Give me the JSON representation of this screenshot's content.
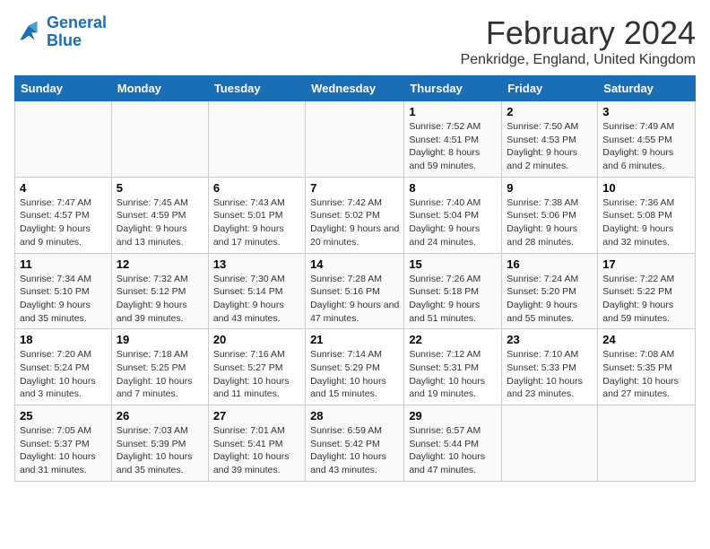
{
  "logo": {
    "line1": "General",
    "line2": "Blue"
  },
  "title": "February 2024",
  "subtitle": "Penkridge, England, United Kingdom",
  "days_of_week": [
    "Sunday",
    "Monday",
    "Tuesday",
    "Wednesday",
    "Thursday",
    "Friday",
    "Saturday"
  ],
  "weeks": [
    [
      {
        "day": "",
        "info": ""
      },
      {
        "day": "",
        "info": ""
      },
      {
        "day": "",
        "info": ""
      },
      {
        "day": "",
        "info": ""
      },
      {
        "day": "1",
        "info": "Sunrise: 7:52 AM\nSunset: 4:51 PM\nDaylight: 8 hours and 59 minutes."
      },
      {
        "day": "2",
        "info": "Sunrise: 7:50 AM\nSunset: 4:53 PM\nDaylight: 9 hours and 2 minutes."
      },
      {
        "day": "3",
        "info": "Sunrise: 7:49 AM\nSunset: 4:55 PM\nDaylight: 9 hours and 6 minutes."
      }
    ],
    [
      {
        "day": "4",
        "info": "Sunrise: 7:47 AM\nSunset: 4:57 PM\nDaylight: 9 hours and 9 minutes."
      },
      {
        "day": "5",
        "info": "Sunrise: 7:45 AM\nSunset: 4:59 PM\nDaylight: 9 hours and 13 minutes."
      },
      {
        "day": "6",
        "info": "Sunrise: 7:43 AM\nSunset: 5:01 PM\nDaylight: 9 hours and 17 minutes."
      },
      {
        "day": "7",
        "info": "Sunrise: 7:42 AM\nSunset: 5:02 PM\nDaylight: 9 hours and 20 minutes."
      },
      {
        "day": "8",
        "info": "Sunrise: 7:40 AM\nSunset: 5:04 PM\nDaylight: 9 hours and 24 minutes."
      },
      {
        "day": "9",
        "info": "Sunrise: 7:38 AM\nSunset: 5:06 PM\nDaylight: 9 hours and 28 minutes."
      },
      {
        "day": "10",
        "info": "Sunrise: 7:36 AM\nSunset: 5:08 PM\nDaylight: 9 hours and 32 minutes."
      }
    ],
    [
      {
        "day": "11",
        "info": "Sunrise: 7:34 AM\nSunset: 5:10 PM\nDaylight: 9 hours and 35 minutes."
      },
      {
        "day": "12",
        "info": "Sunrise: 7:32 AM\nSunset: 5:12 PM\nDaylight: 9 hours and 39 minutes."
      },
      {
        "day": "13",
        "info": "Sunrise: 7:30 AM\nSunset: 5:14 PM\nDaylight: 9 hours and 43 minutes."
      },
      {
        "day": "14",
        "info": "Sunrise: 7:28 AM\nSunset: 5:16 PM\nDaylight: 9 hours and 47 minutes."
      },
      {
        "day": "15",
        "info": "Sunrise: 7:26 AM\nSunset: 5:18 PM\nDaylight: 9 hours and 51 minutes."
      },
      {
        "day": "16",
        "info": "Sunrise: 7:24 AM\nSunset: 5:20 PM\nDaylight: 9 hours and 55 minutes."
      },
      {
        "day": "17",
        "info": "Sunrise: 7:22 AM\nSunset: 5:22 PM\nDaylight: 9 hours and 59 minutes."
      }
    ],
    [
      {
        "day": "18",
        "info": "Sunrise: 7:20 AM\nSunset: 5:24 PM\nDaylight: 10 hours and 3 minutes."
      },
      {
        "day": "19",
        "info": "Sunrise: 7:18 AM\nSunset: 5:25 PM\nDaylight: 10 hours and 7 minutes."
      },
      {
        "day": "20",
        "info": "Sunrise: 7:16 AM\nSunset: 5:27 PM\nDaylight: 10 hours and 11 minutes."
      },
      {
        "day": "21",
        "info": "Sunrise: 7:14 AM\nSunset: 5:29 PM\nDaylight: 10 hours and 15 minutes."
      },
      {
        "day": "22",
        "info": "Sunrise: 7:12 AM\nSunset: 5:31 PM\nDaylight: 10 hours and 19 minutes."
      },
      {
        "day": "23",
        "info": "Sunrise: 7:10 AM\nSunset: 5:33 PM\nDaylight: 10 hours and 23 minutes."
      },
      {
        "day": "24",
        "info": "Sunrise: 7:08 AM\nSunset: 5:35 PM\nDaylight: 10 hours and 27 minutes."
      }
    ],
    [
      {
        "day": "25",
        "info": "Sunrise: 7:05 AM\nSunset: 5:37 PM\nDaylight: 10 hours and 31 minutes."
      },
      {
        "day": "26",
        "info": "Sunrise: 7:03 AM\nSunset: 5:39 PM\nDaylight: 10 hours and 35 minutes."
      },
      {
        "day": "27",
        "info": "Sunrise: 7:01 AM\nSunset: 5:41 PM\nDaylight: 10 hours and 39 minutes."
      },
      {
        "day": "28",
        "info": "Sunrise: 6:59 AM\nSunset: 5:42 PM\nDaylight: 10 hours and 43 minutes."
      },
      {
        "day": "29",
        "info": "Sunrise: 6:57 AM\nSunset: 5:44 PM\nDaylight: 10 hours and 47 minutes."
      },
      {
        "day": "",
        "info": ""
      },
      {
        "day": "",
        "info": ""
      }
    ]
  ]
}
